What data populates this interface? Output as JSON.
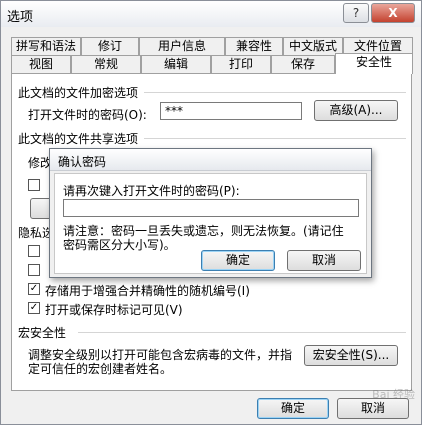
{
  "window": {
    "title": "选项",
    "help_btn": "?",
    "close_btn": "X"
  },
  "tabs_row1": [
    "拼写和语法",
    "修订",
    "用户信息",
    "兼容性",
    "中文版式",
    "文件位置"
  ],
  "tabs_row2": [
    "视图",
    "常规",
    "编辑",
    "打印",
    "保存",
    "安全性"
  ],
  "active_tab": "安全性",
  "encrypt": {
    "heading": "此文档的文件加密选项",
    "open_pw_label": "打开文件时的密码(O):",
    "open_pw_value": "***",
    "advanced_btn": "高级(A)..."
  },
  "sharing": {
    "heading": "此文档的文件共享选项",
    "modify_label": "修改"
  },
  "privacy": {
    "heading": "隐私选",
    "opt1": "存储用于增强合并精确性的随机编号(I)",
    "opt2": "打开或保存时标记可见(V)"
  },
  "macro": {
    "heading": "宏安全性",
    "desc_line1": "调整安全级别以打开可能包含宏病毒的文件，并指",
    "desc_line2": "定可信任的宏创建者姓名。",
    "btn": "宏安全性(S)..."
  },
  "footer": {
    "ok": "确定",
    "cancel": "取消"
  },
  "dialog": {
    "title": "确认密码",
    "prompt": "请再次键入打开文件时的密码(P):",
    "input_value": "",
    "note_line1": "请注意：密码一旦丢失或遗忘，则无法恢复。(请记住",
    "note_line2": "密码需区分大小写)。",
    "ok": "确定",
    "cancel": "取消"
  },
  "watermark": "Bai 经验"
}
